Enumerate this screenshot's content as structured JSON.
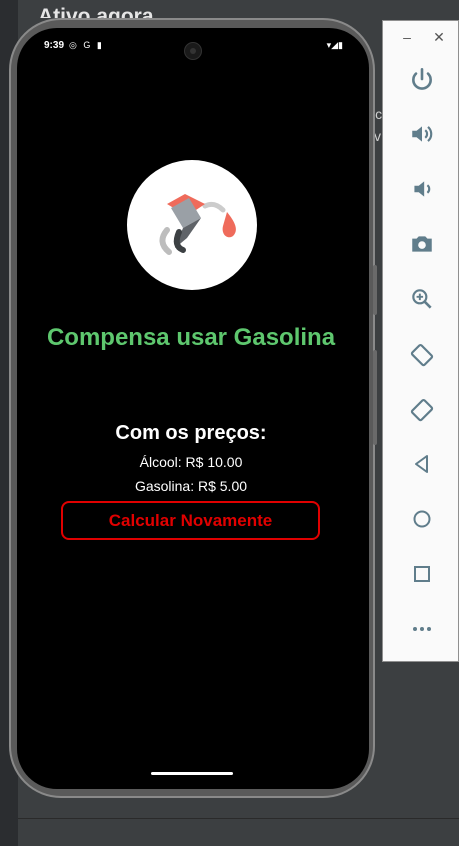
{
  "background": {
    "window_title": "Ativo agora",
    "fragments": [
      "ic",
      "v"
    ]
  },
  "status_bar": {
    "time": "9:39",
    "left_icons": "◎ G ▮",
    "right_icons": "▾◢▮"
  },
  "app": {
    "result_title": "Compensa usar Gasolina",
    "prices_title": "Com os preços:",
    "alcool_line": "Álcool: R$ 10.00",
    "gasolina_line": "Gasolina: R$ 5.00",
    "recalc_button_label": "Calcular Novamente",
    "colors": {
      "result": "#5ec76e",
      "button": "#e00000",
      "pump_handle": "#ef6b5b",
      "drop": "#ef6b5b"
    }
  },
  "emulator_toolbar": {
    "minimize_label": "–",
    "close_label": "✕",
    "buttons": [
      "power-icon",
      "volume-up-icon",
      "volume-down-icon",
      "camera-icon",
      "zoom-icon",
      "rotate-left-icon",
      "rotate-right-icon",
      "back-icon",
      "home-icon",
      "overview-icon",
      "more-icon"
    ]
  }
}
